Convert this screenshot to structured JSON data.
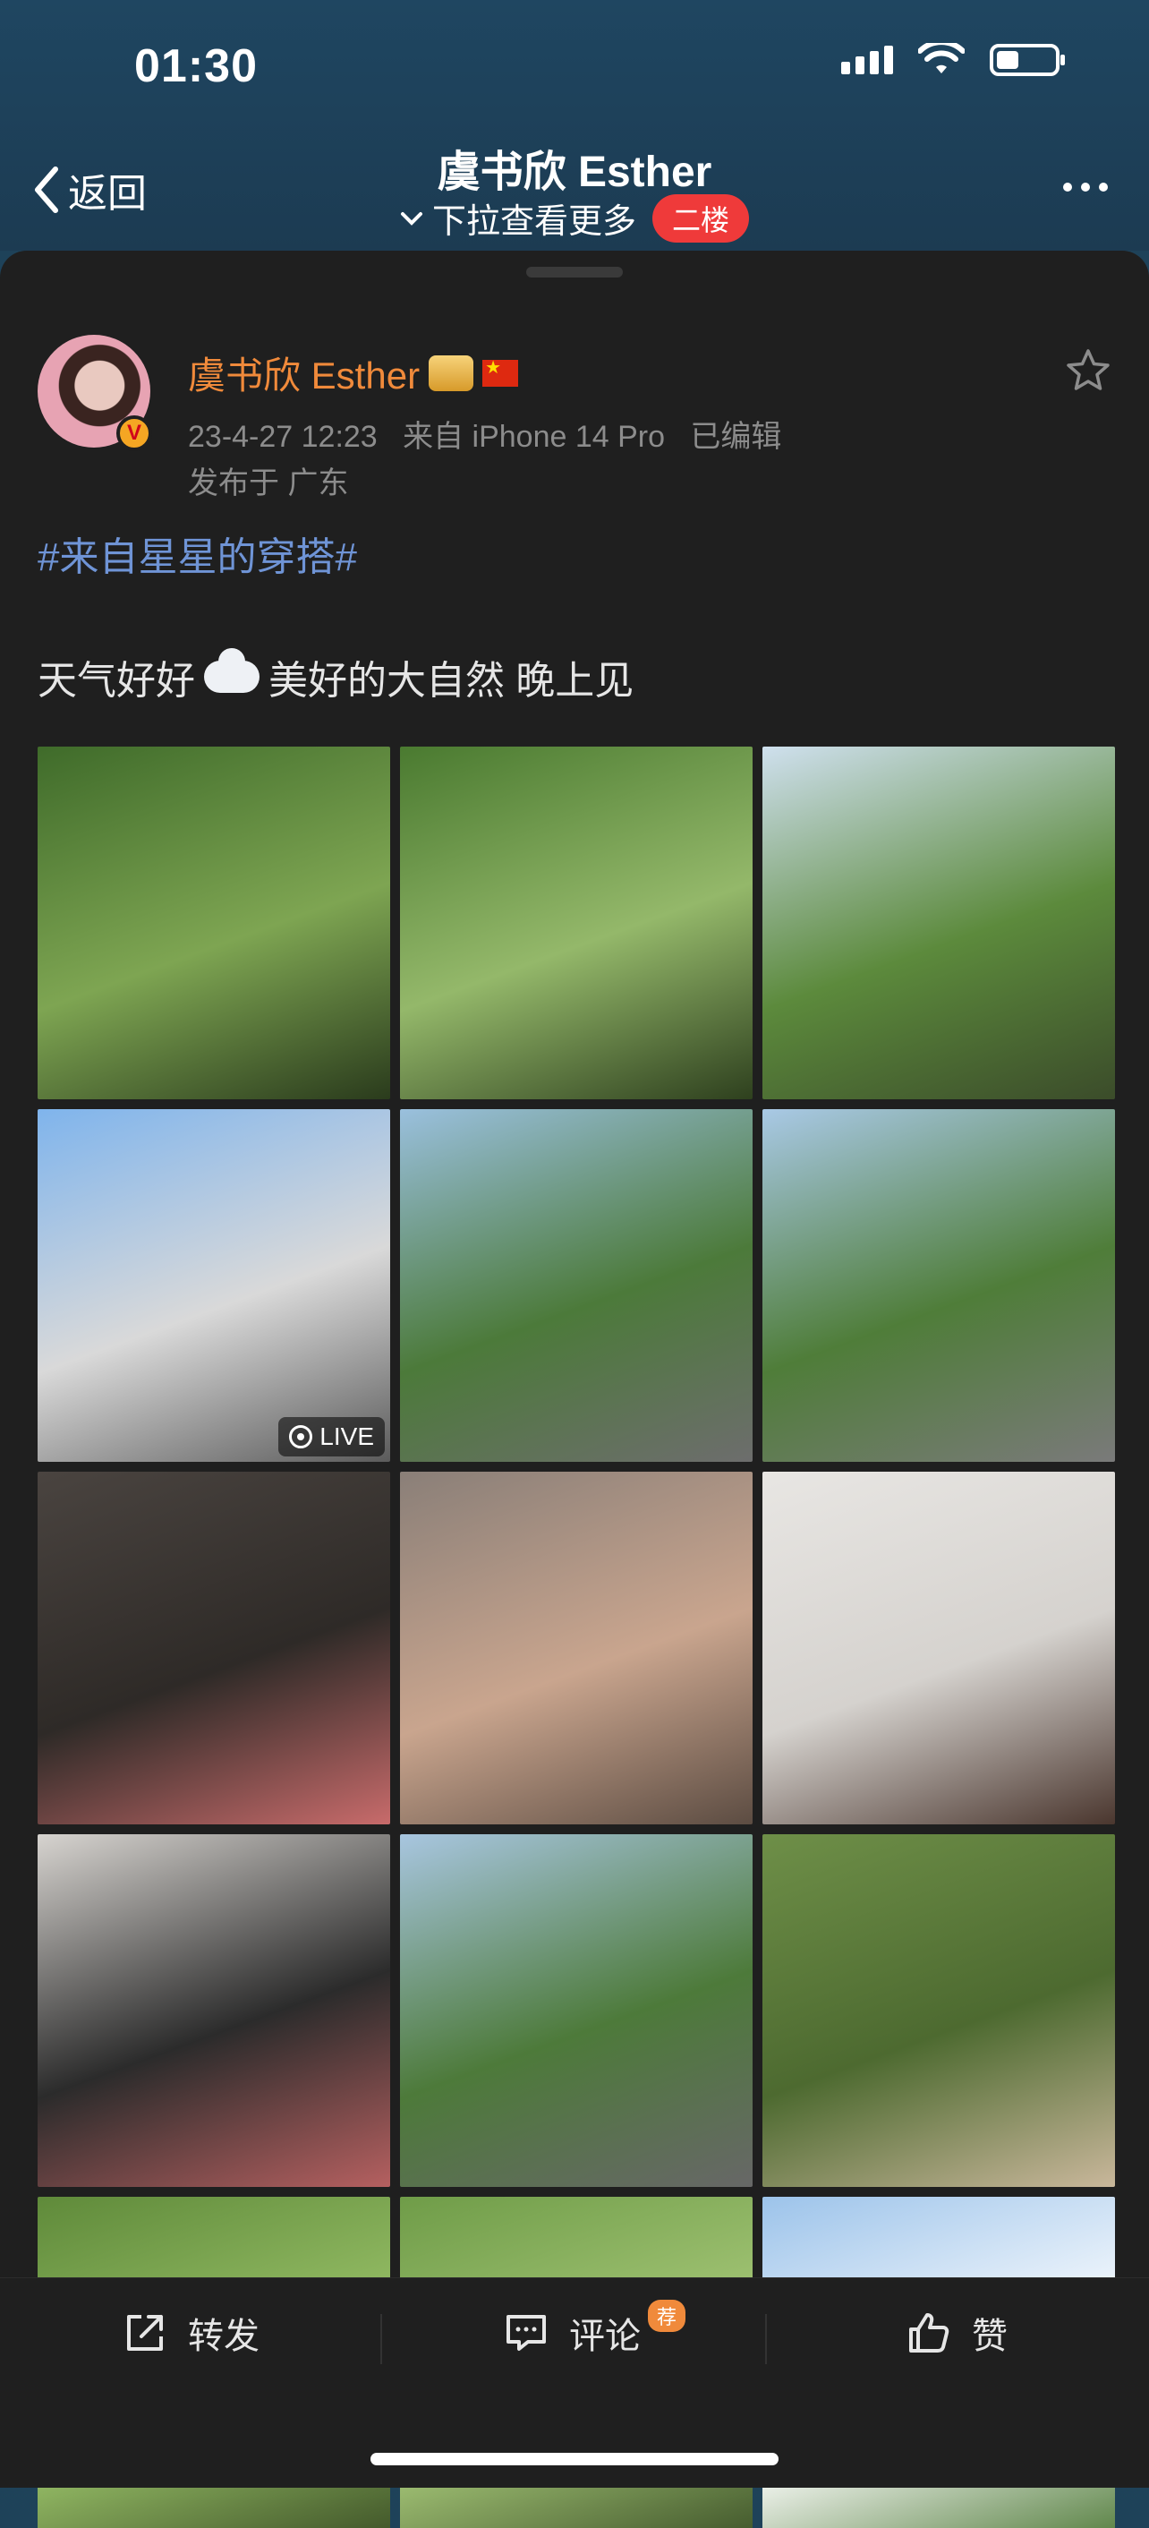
{
  "status_bar": {
    "time": "01:30"
  },
  "nav": {
    "back_label": "返回",
    "title": "虞书欣 Esther",
    "subtitle": "下拉查看更多",
    "floor_badge": "二楼"
  },
  "post": {
    "author": "虞书欣 Esther",
    "verified_badge": "V",
    "timestamp": "23-4-27 12:23",
    "source": "来自 iPhone 14 Pro",
    "edited": "已编辑",
    "location": "发布于 广东",
    "hashtag": "#来自星星的穿搭#",
    "text_before_emoji": "天气好好",
    "text_after_emoji": "美好的大自然 晚上见",
    "photos": [
      {
        "colors": [
          "#3f6b2a",
          "#7ea552",
          "#2a3b1c"
        ]
      },
      {
        "colors": [
          "#4a7a30",
          "#94b86a",
          "#2e401e"
        ]
      },
      {
        "colors": [
          "#cfe0ee",
          "#5c8a3c",
          "#3b4c2a"
        ]
      },
      {
        "colors": [
          "#7fb4ec",
          "#d9d9d9",
          "#5b5b5b"
        ],
        "live": "LIVE"
      },
      {
        "colors": [
          "#9ac0de",
          "#4c7a3a",
          "#6d6d6d"
        ]
      },
      {
        "colors": [
          "#a9c9e6",
          "#4f7d39",
          "#7a7a7a"
        ]
      },
      {
        "colors": [
          "#4a4440",
          "#2e2a27",
          "#c86b6b"
        ]
      },
      {
        "colors": [
          "#8a7f78",
          "#c9a58e",
          "#5c4c42"
        ]
      },
      {
        "colors": [
          "#e8e6e3",
          "#d5d2ce",
          "#4a362e"
        ]
      },
      {
        "colors": [
          "#d7d4d0",
          "#2b2b2b",
          "#b56060"
        ]
      },
      {
        "colors": [
          "#a8c6e0",
          "#4d7a3a",
          "#676767"
        ]
      },
      {
        "colors": [
          "#6e8f48",
          "#4d6a30",
          "#c9b79b"
        ]
      },
      {
        "colors": [
          "#5f8a3a",
          "#9bc36a",
          "#3a4e24"
        ]
      },
      {
        "colors": [
          "#6f9c48",
          "#a8c97a",
          "#3b5026"
        ]
      },
      {
        "colors": [
          "#9cc3ea",
          "#ffffff",
          "#4f7a38"
        ]
      }
    ]
  },
  "actions": {
    "repost": "转发",
    "comment": "评论",
    "comment_badge": "荐",
    "like": "赞"
  },
  "colors": {
    "accent_name": "#f08a3b",
    "hashtag": "#6f94d6",
    "badge_red": "#ef3a3a"
  }
}
